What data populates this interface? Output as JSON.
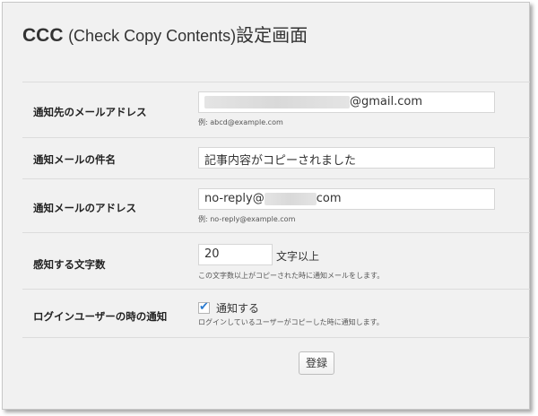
{
  "page": {
    "title_main": "CCC",
    "title_sub": "(Check Copy Contents)",
    "title_suffix": "設定画面"
  },
  "fields": {
    "email": {
      "label": "通知先のメールアドレス",
      "value_suffix": "@gmail.com",
      "description": "例: abcd@example.com"
    },
    "subject": {
      "label": "通知メールの件名",
      "value": "記事内容がコピーされました"
    },
    "from": {
      "label": "通知メールのアドレス",
      "value_prefix": "no-reply@",
      "value_suffix": "com",
      "description": "例: no-reply@example.com"
    },
    "min_chars": {
      "label": "感知する文字数",
      "value": "20",
      "suffix": "文字以上",
      "description": "この文字数以上がコピーされた時に通知メールをします。"
    },
    "logged_in": {
      "label": "ログインユーザーの時の通知",
      "checked": true,
      "checkbox_label": "通知する",
      "description": "ログインしているユーザーがコピーした時に通知します。"
    }
  },
  "submit_label": "登録",
  "colors": {
    "background": "#f1f1f1",
    "checkmark": "#2a7bd1"
  }
}
